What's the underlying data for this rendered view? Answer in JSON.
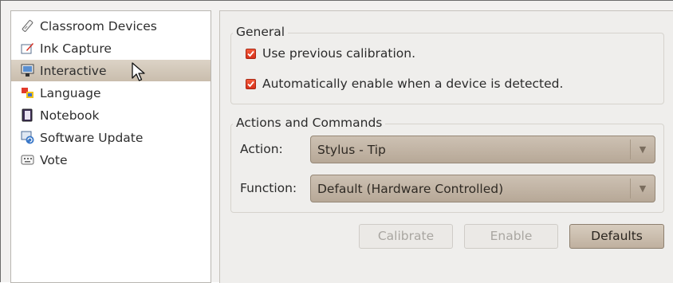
{
  "sidebar": {
    "items": [
      {
        "label": "Classroom Devices",
        "icon": "classroom-devices-icon"
      },
      {
        "label": "Ink Capture",
        "icon": "ink-capture-icon"
      },
      {
        "label": "Interactive",
        "icon": "interactive-icon",
        "selected": true
      },
      {
        "label": "Language",
        "icon": "language-icon"
      },
      {
        "label": "Notebook",
        "icon": "notebook-icon"
      },
      {
        "label": "Software Update",
        "icon": "software-update-icon"
      },
      {
        "label": "Vote",
        "icon": "vote-icon"
      }
    ]
  },
  "general": {
    "title": "General",
    "use_previous_calibration": {
      "label": "Use previous calibration.",
      "checked": true
    },
    "auto_enable": {
      "label": "Automatically enable when a device is detected.",
      "checked": true
    }
  },
  "actions": {
    "title": "Actions and Commands",
    "action_label": "Action:",
    "action_value": "Stylus - Tip",
    "function_label": "Function:",
    "function_value": "Default (Hardware Controlled)"
  },
  "buttons": {
    "calibrate": "Calibrate",
    "enable": "Enable",
    "defaults": "Defaults"
  },
  "colors": {
    "selection": "#cfc4b6",
    "checkbox": "#e5432a",
    "combo": "#c1b4a4"
  }
}
